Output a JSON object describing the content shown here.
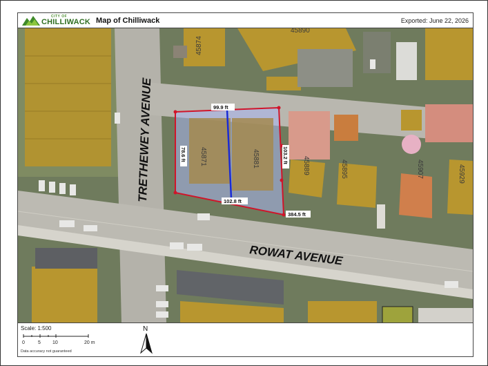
{
  "header": {
    "logo_small": "CITY OF",
    "logo_big": "CHILLIWACK",
    "title": "Map of Chilliwack",
    "exported": "Exported: June 22, 2026"
  },
  "map": {
    "street_labels": [
      "TRETHEWEY AVENUE",
      "ROWAT AVENUE"
    ],
    "address_labels": [
      "45874",
      "45890",
      "45871",
      "45881",
      "45889",
      "45895",
      "45907",
      "45929"
    ],
    "measurements": [
      "99.9 ft",
      "78.6 ft",
      "103.2 ft",
      "102.8 ft",
      "384.5 ft"
    ],
    "colors": {
      "parcel_line": "#d0142a",
      "measure_line": "#1a2bd6",
      "building_fill": "#b8962f",
      "selection_fill": "#aab6f2"
    }
  },
  "footer": {
    "scale": "Scale: 1:500",
    "scale_ticks": [
      "0",
      "5",
      "10",
      "20 m"
    ],
    "north_label": "N",
    "disclaimer": "Data accuracy not guaranteed"
  }
}
